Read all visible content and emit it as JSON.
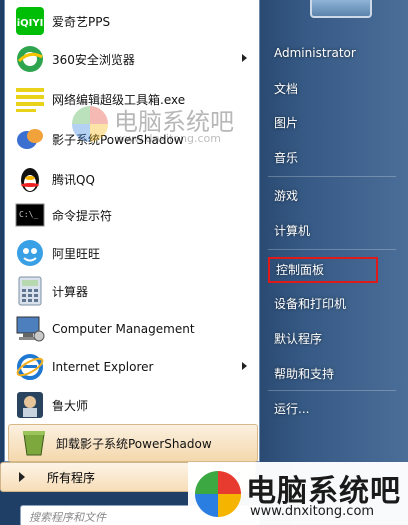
{
  "programs": [
    {
      "label": "爱奇艺PPS",
      "icon": "iqiyi-icon",
      "has_arrow": false
    },
    {
      "label": "360安全浏览器",
      "icon": "360-browser-icon",
      "has_arrow": true
    },
    {
      "label": "网络编辑超级工具箱.exe",
      "icon": "toolbox-icon",
      "has_arrow": false
    },
    {
      "label": "影子系统PowerShadow",
      "icon": "powershadow-icon",
      "has_arrow": false
    },
    {
      "label": "腾讯QQ",
      "icon": "qq-penguin-icon",
      "has_arrow": false
    },
    {
      "label": "命令提示符",
      "icon": "cmd-icon",
      "has_arrow": false
    },
    {
      "label": "阿里旺旺",
      "icon": "aliwangwang-icon",
      "has_arrow": false
    },
    {
      "label": "计算器",
      "icon": "calculator-icon",
      "has_arrow": false
    },
    {
      "label": "Computer Management",
      "icon": "computer-management-icon",
      "has_arrow": false
    },
    {
      "label": "Internet Explorer",
      "icon": "internet-explorer-icon",
      "has_arrow": true
    },
    {
      "label": "鲁大师",
      "icon": "ludashi-icon",
      "has_arrow": false
    },
    {
      "label": "卸载影子系统PowerShadow",
      "icon": "uninstall-icon",
      "has_arrow": false
    }
  ],
  "all_programs": "所有程序",
  "search_placeholder": "搜索程序和文件",
  "right_menu": {
    "user": "Administrator",
    "items": [
      "文档",
      "图片",
      "音乐",
      "游戏",
      "计算机",
      "控制面板",
      "设备和打印机",
      "默认程序",
      "帮助和支持",
      "运行..."
    ],
    "highlighted": "控制面板"
  },
  "watermark": {
    "title": "电脑系统吧",
    "url": "www.dnxitong.com"
  },
  "colors": {
    "highlight_border": "#e01919",
    "selected_item": "#f4d8ad",
    "right_pane": "#365a85"
  }
}
